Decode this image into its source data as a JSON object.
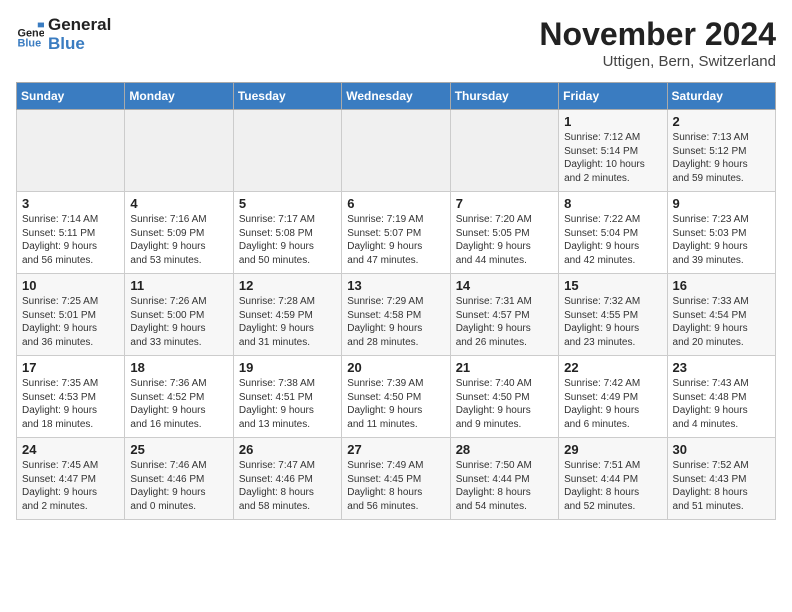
{
  "logo": {
    "line1": "General",
    "line2": "Blue"
  },
  "title": "November 2024",
  "subtitle": "Uttigen, Bern, Switzerland",
  "days_of_week": [
    "Sunday",
    "Monday",
    "Tuesday",
    "Wednesday",
    "Thursday",
    "Friday",
    "Saturday"
  ],
  "weeks": [
    [
      {
        "day": "",
        "info": ""
      },
      {
        "day": "",
        "info": ""
      },
      {
        "day": "",
        "info": ""
      },
      {
        "day": "",
        "info": ""
      },
      {
        "day": "",
        "info": ""
      },
      {
        "day": "1",
        "info": "Sunrise: 7:12 AM\nSunset: 5:14 PM\nDaylight: 10 hours\nand 2 minutes."
      },
      {
        "day": "2",
        "info": "Sunrise: 7:13 AM\nSunset: 5:12 PM\nDaylight: 9 hours\nand 59 minutes."
      }
    ],
    [
      {
        "day": "3",
        "info": "Sunrise: 7:14 AM\nSunset: 5:11 PM\nDaylight: 9 hours\nand 56 minutes."
      },
      {
        "day": "4",
        "info": "Sunrise: 7:16 AM\nSunset: 5:09 PM\nDaylight: 9 hours\nand 53 minutes."
      },
      {
        "day": "5",
        "info": "Sunrise: 7:17 AM\nSunset: 5:08 PM\nDaylight: 9 hours\nand 50 minutes."
      },
      {
        "day": "6",
        "info": "Sunrise: 7:19 AM\nSunset: 5:07 PM\nDaylight: 9 hours\nand 47 minutes."
      },
      {
        "day": "7",
        "info": "Sunrise: 7:20 AM\nSunset: 5:05 PM\nDaylight: 9 hours\nand 44 minutes."
      },
      {
        "day": "8",
        "info": "Sunrise: 7:22 AM\nSunset: 5:04 PM\nDaylight: 9 hours\nand 42 minutes."
      },
      {
        "day": "9",
        "info": "Sunrise: 7:23 AM\nSunset: 5:03 PM\nDaylight: 9 hours\nand 39 minutes."
      }
    ],
    [
      {
        "day": "10",
        "info": "Sunrise: 7:25 AM\nSunset: 5:01 PM\nDaylight: 9 hours\nand 36 minutes."
      },
      {
        "day": "11",
        "info": "Sunrise: 7:26 AM\nSunset: 5:00 PM\nDaylight: 9 hours\nand 33 minutes."
      },
      {
        "day": "12",
        "info": "Sunrise: 7:28 AM\nSunset: 4:59 PM\nDaylight: 9 hours\nand 31 minutes."
      },
      {
        "day": "13",
        "info": "Sunrise: 7:29 AM\nSunset: 4:58 PM\nDaylight: 9 hours\nand 28 minutes."
      },
      {
        "day": "14",
        "info": "Sunrise: 7:31 AM\nSunset: 4:57 PM\nDaylight: 9 hours\nand 26 minutes."
      },
      {
        "day": "15",
        "info": "Sunrise: 7:32 AM\nSunset: 4:55 PM\nDaylight: 9 hours\nand 23 minutes."
      },
      {
        "day": "16",
        "info": "Sunrise: 7:33 AM\nSunset: 4:54 PM\nDaylight: 9 hours\nand 20 minutes."
      }
    ],
    [
      {
        "day": "17",
        "info": "Sunrise: 7:35 AM\nSunset: 4:53 PM\nDaylight: 9 hours\nand 18 minutes."
      },
      {
        "day": "18",
        "info": "Sunrise: 7:36 AM\nSunset: 4:52 PM\nDaylight: 9 hours\nand 16 minutes."
      },
      {
        "day": "19",
        "info": "Sunrise: 7:38 AM\nSunset: 4:51 PM\nDaylight: 9 hours\nand 13 minutes."
      },
      {
        "day": "20",
        "info": "Sunrise: 7:39 AM\nSunset: 4:50 PM\nDaylight: 9 hours\nand 11 minutes."
      },
      {
        "day": "21",
        "info": "Sunrise: 7:40 AM\nSunset: 4:50 PM\nDaylight: 9 hours\nand 9 minutes."
      },
      {
        "day": "22",
        "info": "Sunrise: 7:42 AM\nSunset: 4:49 PM\nDaylight: 9 hours\nand 6 minutes."
      },
      {
        "day": "23",
        "info": "Sunrise: 7:43 AM\nSunset: 4:48 PM\nDaylight: 9 hours\nand 4 minutes."
      }
    ],
    [
      {
        "day": "24",
        "info": "Sunrise: 7:45 AM\nSunset: 4:47 PM\nDaylight: 9 hours\nand 2 minutes."
      },
      {
        "day": "25",
        "info": "Sunrise: 7:46 AM\nSunset: 4:46 PM\nDaylight: 9 hours\nand 0 minutes."
      },
      {
        "day": "26",
        "info": "Sunrise: 7:47 AM\nSunset: 4:46 PM\nDaylight: 8 hours\nand 58 minutes."
      },
      {
        "day": "27",
        "info": "Sunrise: 7:49 AM\nSunset: 4:45 PM\nDaylight: 8 hours\nand 56 minutes."
      },
      {
        "day": "28",
        "info": "Sunrise: 7:50 AM\nSunset: 4:44 PM\nDaylight: 8 hours\nand 54 minutes."
      },
      {
        "day": "29",
        "info": "Sunrise: 7:51 AM\nSunset: 4:44 PM\nDaylight: 8 hours\nand 52 minutes."
      },
      {
        "day": "30",
        "info": "Sunrise: 7:52 AM\nSunset: 4:43 PM\nDaylight: 8 hours\nand 51 minutes."
      }
    ]
  ]
}
